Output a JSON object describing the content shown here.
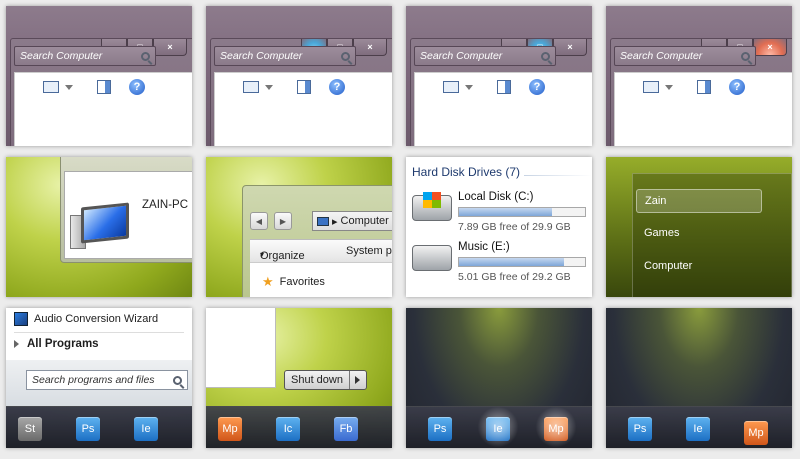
{
  "captions": {
    "minimize": "–",
    "maximize": "□",
    "close": "×",
    "tiles": [
      {
        "state": "normal"
      },
      {
        "state": "minimize-hover"
      },
      {
        "state": "maximize-hover"
      },
      {
        "state": "close-hover"
      }
    ]
  },
  "search_computer": {
    "placeholder": "Search Computer",
    "icon": "search-icon"
  },
  "toolbar": {
    "help_label": "?",
    "views_icon": "views-icon",
    "pane_icon": "preview-pane-icon",
    "help_icon": "help-icon"
  },
  "computer": {
    "name": "ZAIN-PC",
    "icon": "computer-icon"
  },
  "explorer": {
    "address": "Computer",
    "back_label": "◀",
    "forward_label": "▶",
    "organize": "Organize",
    "system": "System p",
    "favorites": "Favorites"
  },
  "drives": {
    "header": "Hard Disk Drives (7)",
    "items": [
      {
        "name": "Local Disk (C:)",
        "free": "7.89 GB free of 29.9 GB",
        "used_fraction": 0.74,
        "icon": "windows-drive-icon"
      },
      {
        "name": "Music (E:)",
        "free": "5.01 GB free of 29.2 GB",
        "used_fraction": 0.83,
        "icon": "drive-icon"
      }
    ]
  },
  "start_right": {
    "items": [
      "Zain",
      "Games",
      "Computer"
    ],
    "selected": "Zain"
  },
  "start_left": {
    "recent_program": "Audio Conversion Wizard",
    "all_programs": "All Programs",
    "search_placeholder": "Search programs and files"
  },
  "shutdown": {
    "label": "Shut down"
  },
  "taskbars": [
    {
      "apps": [
        "St",
        "Ps",
        "Ie"
      ]
    },
    {
      "apps": [
        "Mp",
        "Ic",
        "Fb"
      ]
    },
    {
      "apps": [
        "Ps",
        "Ie",
        "Mp"
      ],
      "glow": [
        1,
        2
      ]
    },
    {
      "apps": [
        "Ps",
        "Ie",
        "Mp"
      ],
      "glow": []
    }
  ],
  "colors": {
    "frame": "#7a6579",
    "accent_green": "#8fa81d",
    "selection_blue": "#4aa7d8",
    "close_red": "#e16d52"
  }
}
